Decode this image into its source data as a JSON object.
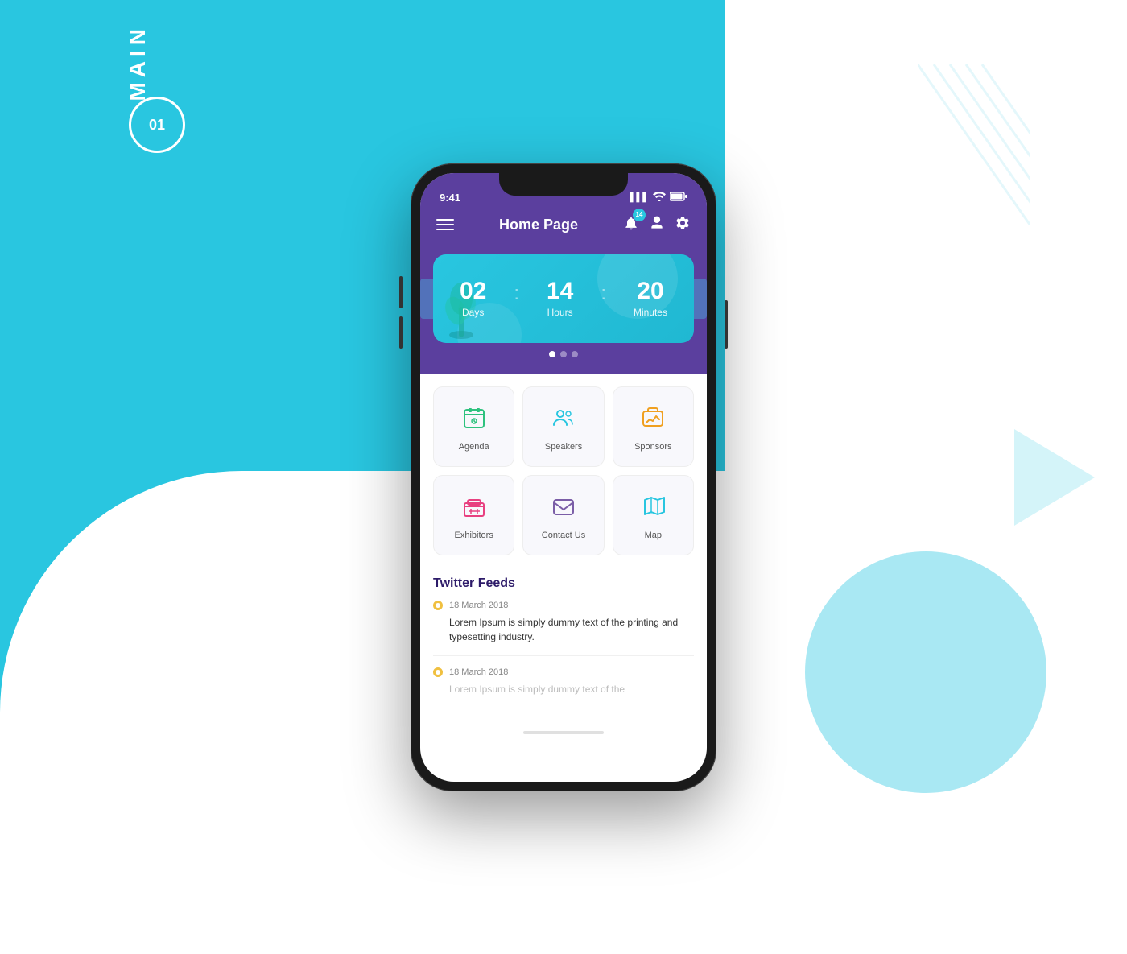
{
  "background": {
    "label_main": "MAIN",
    "label_number": "01"
  },
  "status_bar": {
    "time": "9:41",
    "signal": "▌▌▌",
    "wifi": "WiFi",
    "battery": "🔋"
  },
  "header": {
    "title": "Home Page",
    "notif_count": "14"
  },
  "countdown": {
    "days_value": "02",
    "days_label": "Days",
    "hours_value": "14",
    "hours_label": "Hours",
    "minutes_value": "20",
    "minutes_label": "Minutes"
  },
  "menu_items": [
    {
      "id": "agenda",
      "label": "Agenda",
      "icon": "📅",
      "color": "#2ec27e"
    },
    {
      "id": "speakers",
      "label": "Speakers",
      "icon": "👥",
      "color": "#29c6e0"
    },
    {
      "id": "sponsors",
      "label": "Sponsors",
      "icon": "🤝",
      "color": "#f0a020"
    },
    {
      "id": "exhibitors",
      "label": "Exhibitors",
      "icon": "🏪",
      "color": "#e84080"
    },
    {
      "id": "contact",
      "label": "Contact Us",
      "icon": "✉️",
      "color": "#7b5ea7"
    },
    {
      "id": "map",
      "label": "Map",
      "icon": "🗺️",
      "color": "#29c6e0"
    }
  ],
  "twitter": {
    "section_title": "Twitter Feeds",
    "tweets": [
      {
        "date": "18 March 2018",
        "text": "Lorem Ipsum is simply dummy text of the printing and typesetting industry."
      },
      {
        "date": "18 March 2018",
        "text": "Lorem Ipsum is simply dummy text of the"
      }
    ]
  }
}
